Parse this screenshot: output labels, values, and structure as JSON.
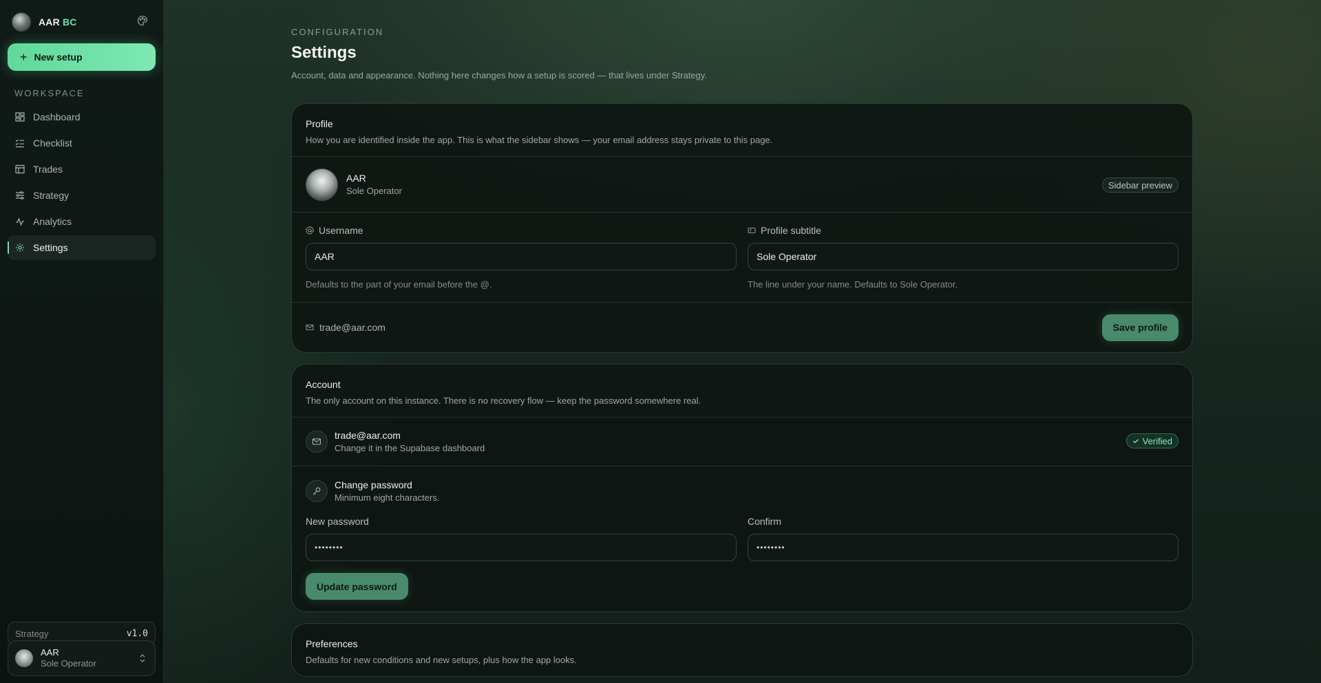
{
  "brand": {
    "name": "AAR",
    "accent": "BC"
  },
  "sidebar": {
    "new_setup_label": "New setup",
    "section_label": "WORKSPACE",
    "items": [
      {
        "label": "Dashboard",
        "icon": "dashboard-icon"
      },
      {
        "label": "Checklist",
        "icon": "checklist-icon"
      },
      {
        "label": "Trades",
        "icon": "table-icon"
      },
      {
        "label": "Strategy",
        "icon": "sliders-icon"
      },
      {
        "label": "Analytics",
        "icon": "activity-icon"
      },
      {
        "label": "Settings",
        "icon": "gear-icon",
        "active": true
      }
    ],
    "strategy": {
      "label": "Strategy",
      "version": "v1.0"
    },
    "user": {
      "name": "AAR",
      "subtitle": "Sole Operator"
    }
  },
  "header": {
    "eyebrow": "CONFIGURATION",
    "title": "Settings",
    "description": "Account, data and appearance. Nothing here changes how a setup is scored — that lives under Strategy."
  },
  "profile": {
    "title": "Profile",
    "subtitle": "How you are identified inside the app. This is what the sidebar shows — your email address stays private to this page.",
    "preview": {
      "name": "AAR",
      "subtitle": "Sole Operator",
      "badge": "Sidebar preview"
    },
    "username": {
      "label": "Username",
      "value": "AAR",
      "hint": "Defaults to the part of your email before the @."
    },
    "profile_subtitle": {
      "label": "Profile subtitle",
      "value": "Sole Operator",
      "hint": "The line under your name. Defaults to Sole Operator."
    },
    "email": "trade@aar.com",
    "save_label": "Save profile"
  },
  "account": {
    "title": "Account",
    "subtitle": "The only account on this instance. There is no recovery flow — keep the password somewhere real.",
    "email": {
      "value": "trade@aar.com",
      "note": "Change it in the Supabase dashboard",
      "badge": "Verified"
    },
    "password": {
      "title": "Change password",
      "note": "Minimum eight characters.",
      "new_label": "New password",
      "new_value": "••••••••",
      "confirm_label": "Confirm",
      "confirm_value": "••••••••",
      "button": "Update password"
    }
  },
  "preferences": {
    "title": "Preferences",
    "subtitle": "Defaults for new conditions and new setups, plus how the app looks."
  },
  "colors": {
    "accent": "#6fe3a8",
    "button": "#4a8a6c"
  }
}
